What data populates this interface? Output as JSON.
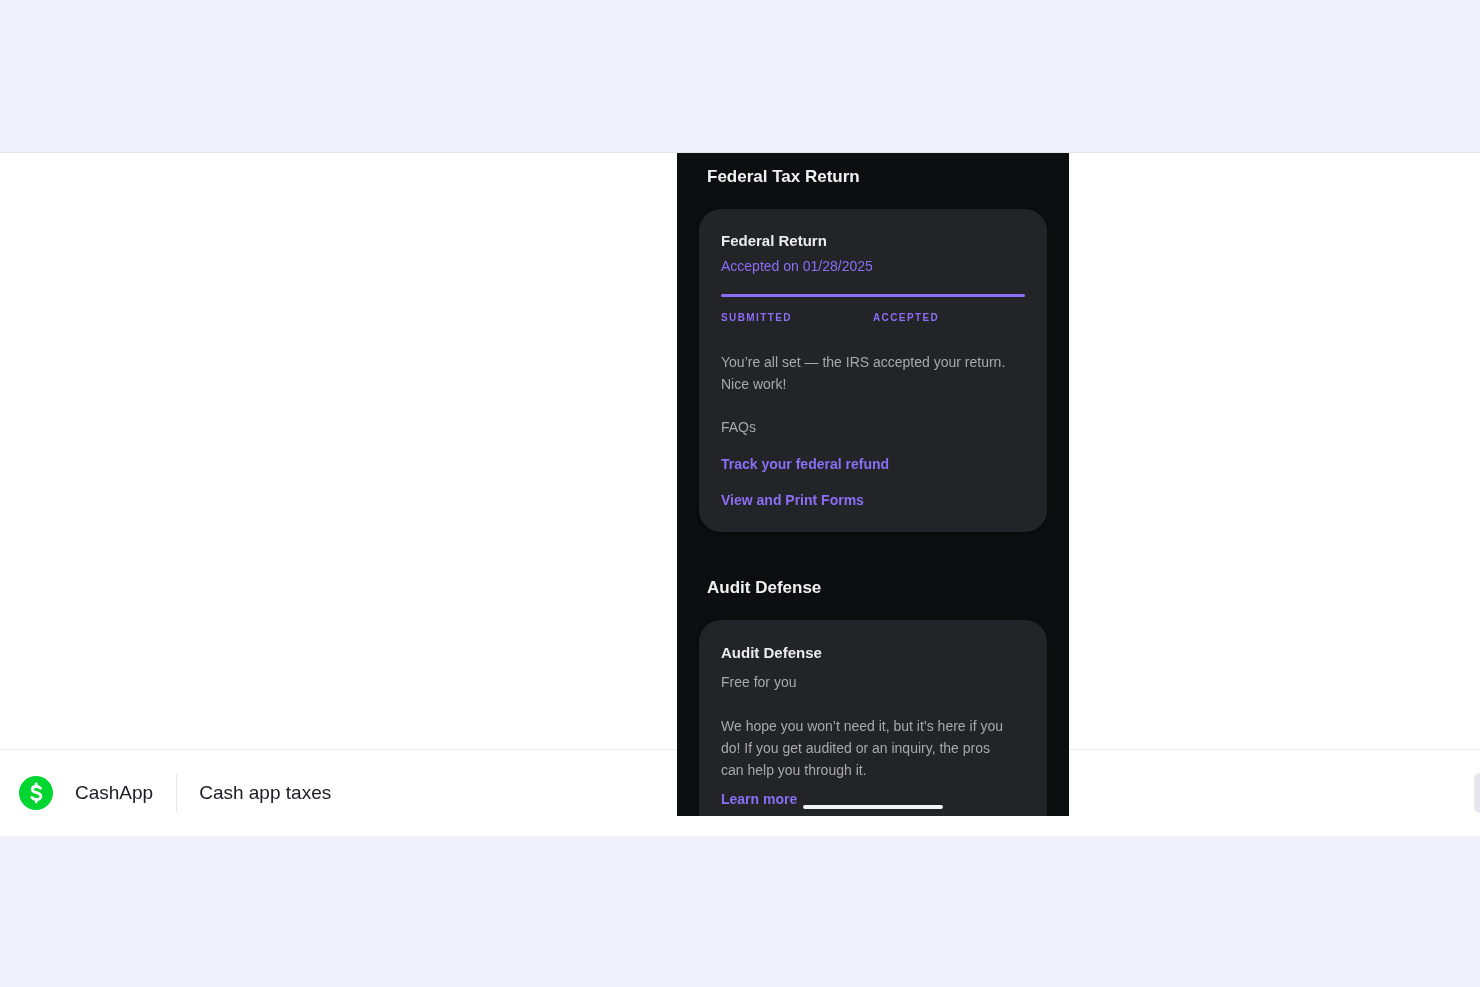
{
  "app_bar": {
    "app_name": "CashApp",
    "page_title": "Cash app taxes"
  },
  "phone": {
    "sections": [
      {
        "heading": "Federal Tax Return",
        "card": {
          "kind": "status",
          "title": "Federal Return",
          "status": "Accepted on 01/28/2025",
          "progress": {
            "level": 1,
            "steps": [
              {
                "label": "SUBMITTED",
                "done": true
              },
              {
                "label": "ACCEPTED",
                "done": true
              }
            ]
          },
          "message": "You’re all set — the IRS accepted your return. Nice work!",
          "faq_heading": "FAQs",
          "links": [
            "Track your federal refund",
            "View and Print Forms"
          ]
        }
      },
      {
        "heading": "Audit Defense",
        "card": {
          "kind": "offer",
          "title": "Audit Defense",
          "subtitle": "Free for you",
          "message": "We hope you won’t need it, but it’s here if you do! If you get audited or an inquiry, the pros can help you through it.",
          "links": [
            "Learn more"
          ]
        }
      }
    ]
  }
}
